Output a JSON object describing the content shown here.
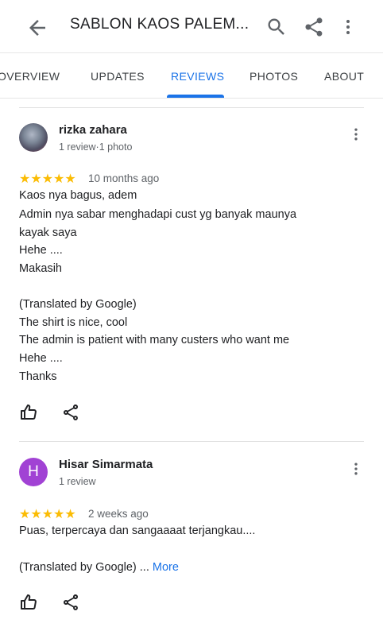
{
  "appbar": {
    "title": "SABLON KAOS PALEM...",
    "icons": [
      "arrow-back-icon",
      "search-icon",
      "share-icon",
      "more-vert-icon"
    ]
  },
  "tabs": [
    {
      "label": "OVERVIEW",
      "active": false
    },
    {
      "label": "UPDATES",
      "active": false
    },
    {
      "label": "REVIEWS",
      "active": true
    },
    {
      "label": "PHOTOS",
      "active": false
    },
    {
      "label": "ABOUT",
      "active": false
    }
  ],
  "colors": {
    "accent": "#1a73e8",
    "star": "#fbbc04",
    "avatar_h": "#a142d4"
  },
  "reviews": [
    {
      "author": "rizka zahara",
      "meta": "1 review·1 photo",
      "rating": 5,
      "stars": "★★★★★",
      "time": "10 months ago",
      "lines": [
        "Kaos nya bagus, adem",
        "Admin nya sabar menghadapi cust yg banyak maunya",
        "kayak saya",
        "Hehe ....",
        "Makasih",
        "(Translated by Google)",
        "The shirt is nice, cool",
        "The admin is patient with many custers who want me",
        "Hehe ....",
        "Thanks"
      ]
    },
    {
      "author": "Hisar Simarmata",
      "avatar_letter": "H",
      "meta": "1 review",
      "rating": 5,
      "stars": "★★★★★",
      "time": "2 weeks ago",
      "lines": [
        "Puas, terpercaya dan sangaaaat terjangkau....",
        "(Translated by Google) ..."
      ],
      "more_label": "More"
    }
  ]
}
